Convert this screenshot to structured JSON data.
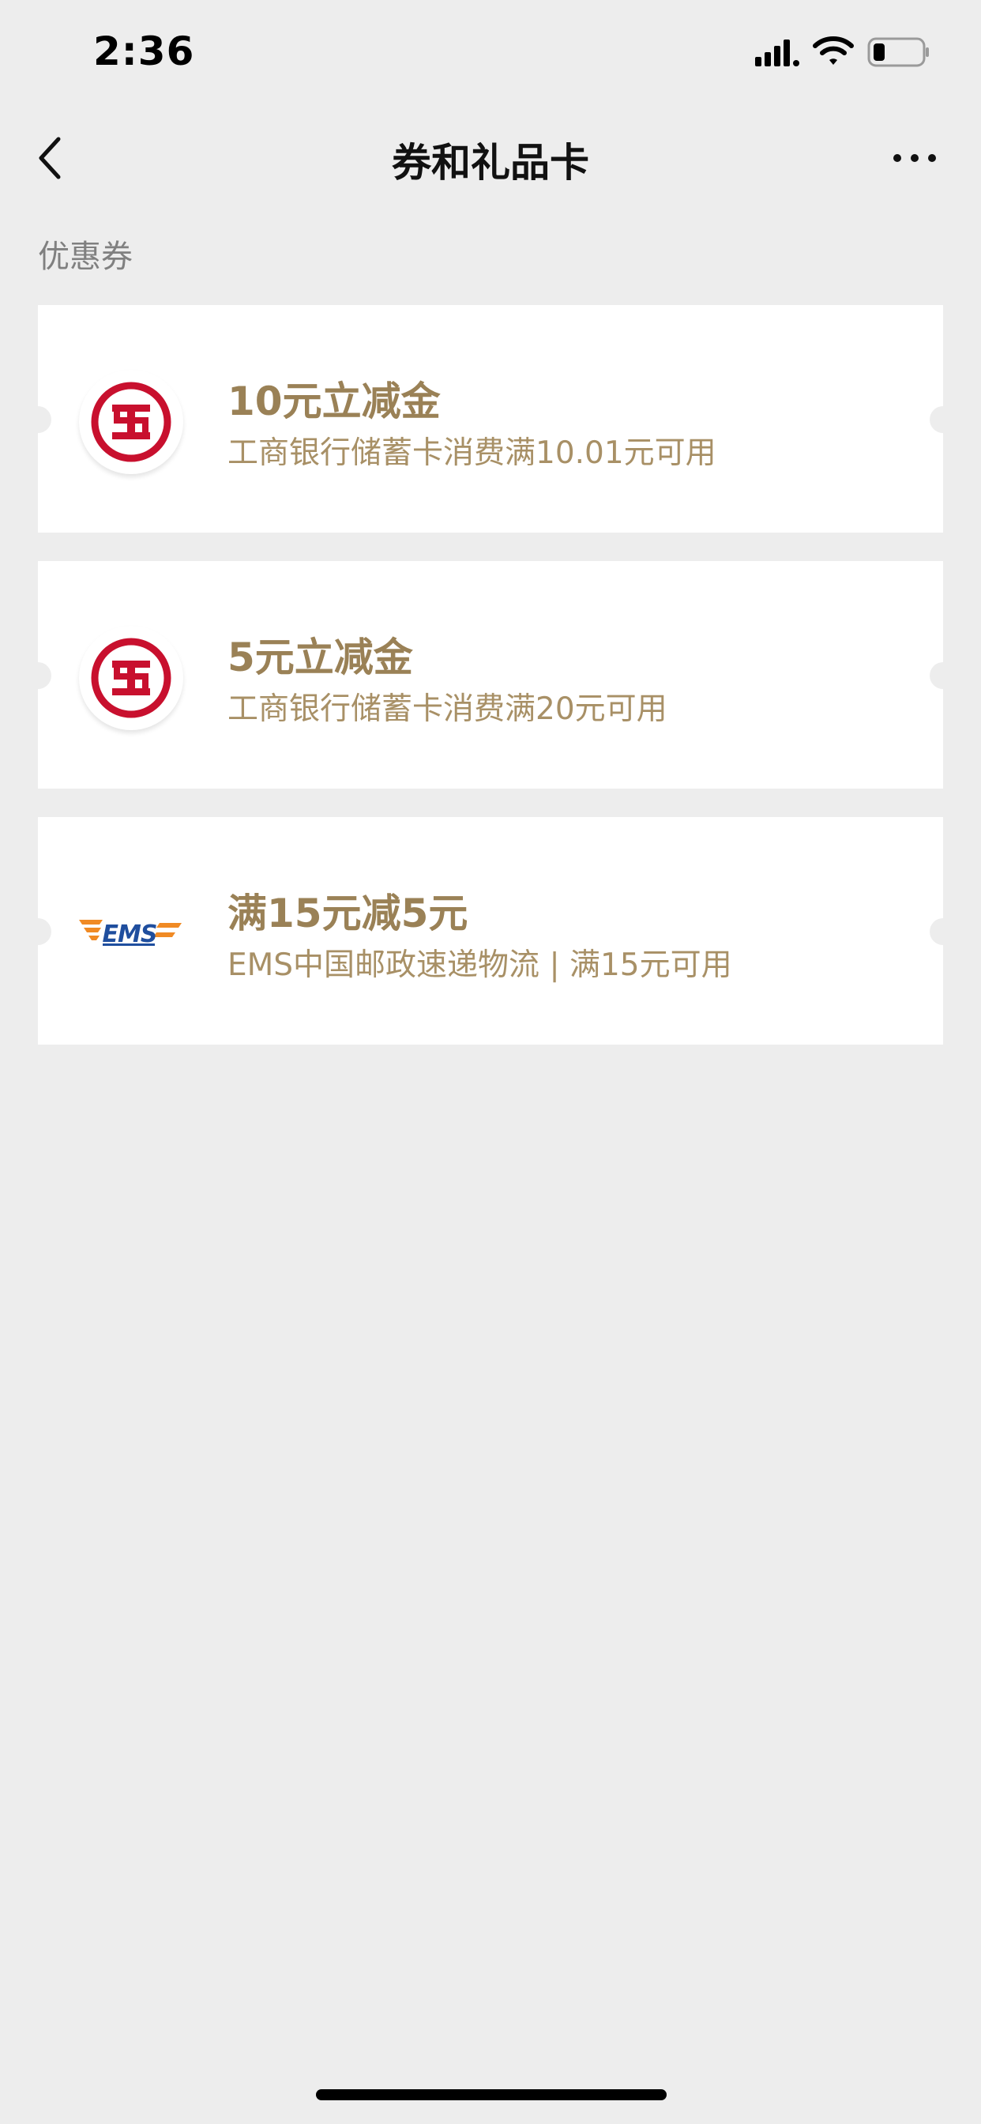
{
  "status_bar": {
    "time": "2:36"
  },
  "nav": {
    "title": "券和礼品卡"
  },
  "section": {
    "label": "优惠券"
  },
  "coupons": [
    {
      "name": "10元立减金",
      "desc": "工商银行储蓄卡消费满10.01元可用",
      "logo": "icbc-logo-icon"
    },
    {
      "name": "5元立减金",
      "desc": "工商银行储蓄卡消费满20元可用",
      "logo": "icbc-logo-icon"
    },
    {
      "name": "满15元减5元",
      "desc": "EMS中国邮政速递物流 | 满15元可用",
      "logo": "ems-logo-icon"
    }
  ],
  "colors": {
    "background": "#ededed",
    "card": "#ffffff",
    "coupon_title": "#9a8156",
    "coupon_desc": "#a89066",
    "icbc_red": "#c8102e",
    "ems_blue": "#1f4e9e",
    "ems_orange": "#f08a24"
  }
}
